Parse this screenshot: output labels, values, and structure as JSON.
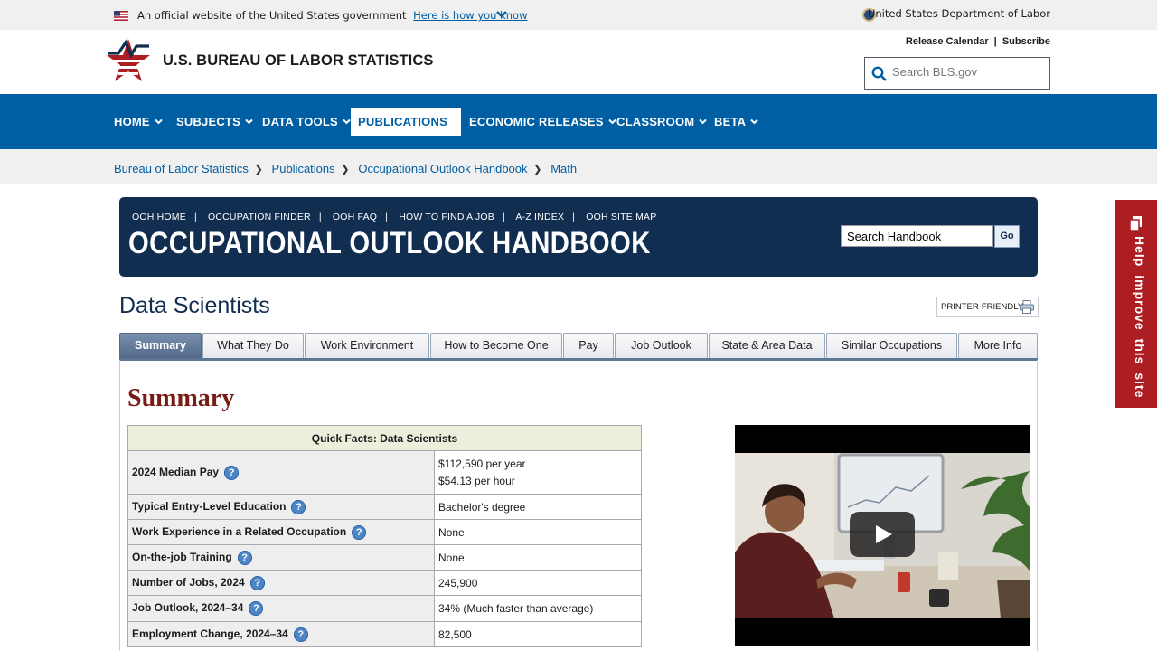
{
  "gov_banner": {
    "official_text": "An official website of the United States government",
    "how_link": "Here is how you know",
    "department": "United States Department of Labor"
  },
  "header": {
    "site_title": "U.S. BUREAU OF LABOR STATISTICS",
    "release_calendar": "Release Calendar",
    "separator": "|",
    "subscribe": "Subscribe",
    "search_placeholder": "Search BLS.gov"
  },
  "nav": {
    "items": [
      {
        "label": "HOME"
      },
      {
        "label": "SUBJECTS"
      },
      {
        "label": "DATA TOOLS"
      },
      {
        "label": "PUBLICATIONS"
      },
      {
        "label": "ECONOMIC RELEASES"
      },
      {
        "label": "CLASSROOM"
      },
      {
        "label": "BETA"
      }
    ],
    "active_index": 3
  },
  "breadcrumb": [
    "Bureau of Labor Statistics",
    "Publications",
    "Occupational Outlook Handbook",
    "Math"
  ],
  "ooh": {
    "nav": [
      "OOH HOME",
      "OCCUPATION FINDER",
      "OOH FAQ",
      "HOW TO FIND A JOB",
      "A-Z INDEX",
      "OOH SITE MAP"
    ],
    "title": "OCCUPATIONAL OUTLOOK HANDBOOK",
    "search_value": "Search Handbook",
    "go_label": "Go"
  },
  "feedback": {
    "label": "Help improve this site"
  },
  "page": {
    "title": "Data Scientists",
    "printer_label": "PRINTER-FRIENDLY"
  },
  "tabs": [
    "Summary",
    "What They Do",
    "Work Environment",
    "How to Become One",
    "Pay",
    "Job Outlook",
    "State & Area Data",
    "Similar Occupations",
    "More Info"
  ],
  "summary": {
    "heading": "Summary",
    "quick_facts": {
      "title": "Quick Facts: Data Scientists",
      "rows": [
        {
          "label": "2024 Median Pay",
          "value": "$112,590 per year",
          "value2": "$54.13 per hour"
        },
        {
          "label": "Typical Entry-Level Education",
          "value": "Bachelor's degree"
        },
        {
          "label": "Work Experience in a Related Occupation",
          "value": "None"
        },
        {
          "label": "On-the-job Training",
          "value": "None"
        },
        {
          "label": "Number of Jobs, 2024",
          "value": "245,900"
        },
        {
          "label": "Job Outlook, 2024–34",
          "value": "34% (Much faster than average)"
        },
        {
          "label": "Employment Change, 2024–34",
          "value": "82,500"
        }
      ],
      "help_glyph": "?"
    }
  },
  "colors": {
    "nav_blue": "#005ea2",
    "ooh_navy": "#112e51",
    "feedback_red": "#ad1e23",
    "summary_red": "#7a1c16"
  }
}
